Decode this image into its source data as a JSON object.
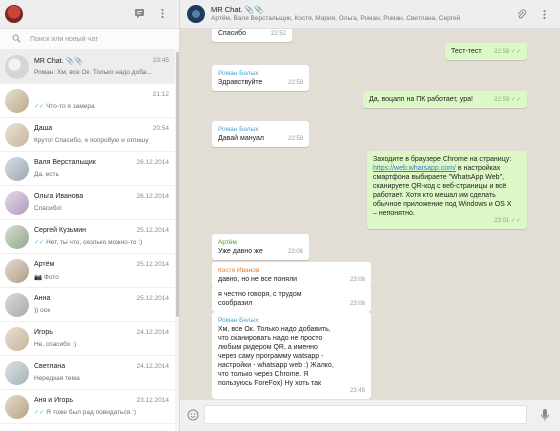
{
  "colors": {
    "accent": "#4fb8e3",
    "outgoing_bubble": "#dcf8c6",
    "chat_bg": "#e2ddd5"
  },
  "left": {
    "search_placeholder": "Поиск или новый чат",
    "chats": [
      {
        "name": "MR Chat. 📎📎",
        "time": "23:45",
        "preview": "Роман: Хм, все Ок. Только надо доба...",
        "active": true,
        "tick": false
      },
      {
        "name": "",
        "time": "21:12",
        "preview": "Что-то я замера",
        "active": false,
        "tick": true
      },
      {
        "name": "Даша",
        "time": "20:54",
        "preview": "Круто! Спасибо, я попробую и отпишу",
        "active": false,
        "tick": false
      },
      {
        "name": "Валя Верстальщик",
        "time": "26.12.2014",
        "preview": "Да, есть",
        "active": false,
        "tick": false
      },
      {
        "name": "Ольга Иванова",
        "time": "26.12.2014",
        "preview": "Спасибо!",
        "active": false,
        "tick": false
      },
      {
        "name": "Сергей Кузьмин",
        "time": "25.12.2014",
        "preview": "Нет, ты что, сколько можно-то :)",
        "active": false,
        "tick": true
      },
      {
        "name": "Артём",
        "time": "25.12.2014",
        "preview": "📷 Фото",
        "active": false,
        "tick": false
      },
      {
        "name": "Анна",
        "time": "25.12.2014",
        "preview": ")) оок",
        "active": false,
        "tick": false
      },
      {
        "name": "Игорь",
        "time": "24.12.2014",
        "preview": "Не, спасибо :)",
        "active": false,
        "tick": false
      },
      {
        "name": "Светлана",
        "time": "24.12.2014",
        "preview": "Нередкая тема",
        "active": false,
        "tick": false
      },
      {
        "name": "Аня и Игорь",
        "time": "23.12.2014",
        "preview": "Я тоже был рад повидаться :)",
        "active": false,
        "tick": true
      }
    ]
  },
  "header": {
    "title": "MR Chat. 📎📎",
    "members": "Артём, Валя Верстальщик, Костя, Мария, Ольга, Роман, Роман, Светлана, Сергей"
  },
  "messages": [
    {
      "dir": "in",
      "author": "",
      "author_color": "",
      "text": "Спасибо",
      "time": "22:52"
    },
    {
      "dir": "out",
      "author": "",
      "author_color": "",
      "text": "Тест-тест",
      "time": "22:58"
    },
    {
      "dir": "in",
      "author": "Роман Белых",
      "author_color": "#4fa3d6",
      "text": "Здравствуйте",
      "time": "22:59"
    },
    {
      "dir": "out",
      "author": "",
      "author_color": "",
      "text": "Да, воцапп на ПК работает, ура!",
      "time": "22:59"
    },
    {
      "dir": "in",
      "author": "Роман Белых",
      "author_color": "#4fa3d6",
      "text": "Давай мануал",
      "time": "22:59"
    },
    {
      "dir": "out",
      "author": "",
      "author_color": "",
      "text_before": "Заходите в браузере Chrome на страницу: ",
      "link": "https://web.whatsapp.com/",
      "text_after": " в настройках смартфона выбираете \"WhatsApp Web\", сканируете QR-код с веб-страницы и всё работает. Хотя кто мешал им сделать обычное приложение под Windows и OS X – непонятно.",
      "time": "23:01"
    },
    {
      "dir": "in",
      "author": "Артём",
      "author_color": "#4c9a2a",
      "text": "Уже давно же",
      "time": "23:08"
    },
    {
      "dir": "in",
      "author": "Костя Иванов",
      "author_color": "#e07b39",
      "text": "давно, но не все поняли",
      "time": "23:08"
    },
    {
      "dir": "in",
      "author": "",
      "author_color": "",
      "text": "я честно говоря, с трудом сообразил",
      "time": "23:08"
    },
    {
      "dir": "in",
      "author": "Роман Белых",
      "author_color": "#4fa3d6",
      "text": "Хм, все Ок. Только надо добавить, что сканировать надо не просто любым ридером QR, а именно через саму программу watsapp - настройки - whatsapp web :) Жалко, что только через Chrome. Я пользуюсь ForeFox) Ну хоть так",
      "time": "23:45"
    }
  ]
}
